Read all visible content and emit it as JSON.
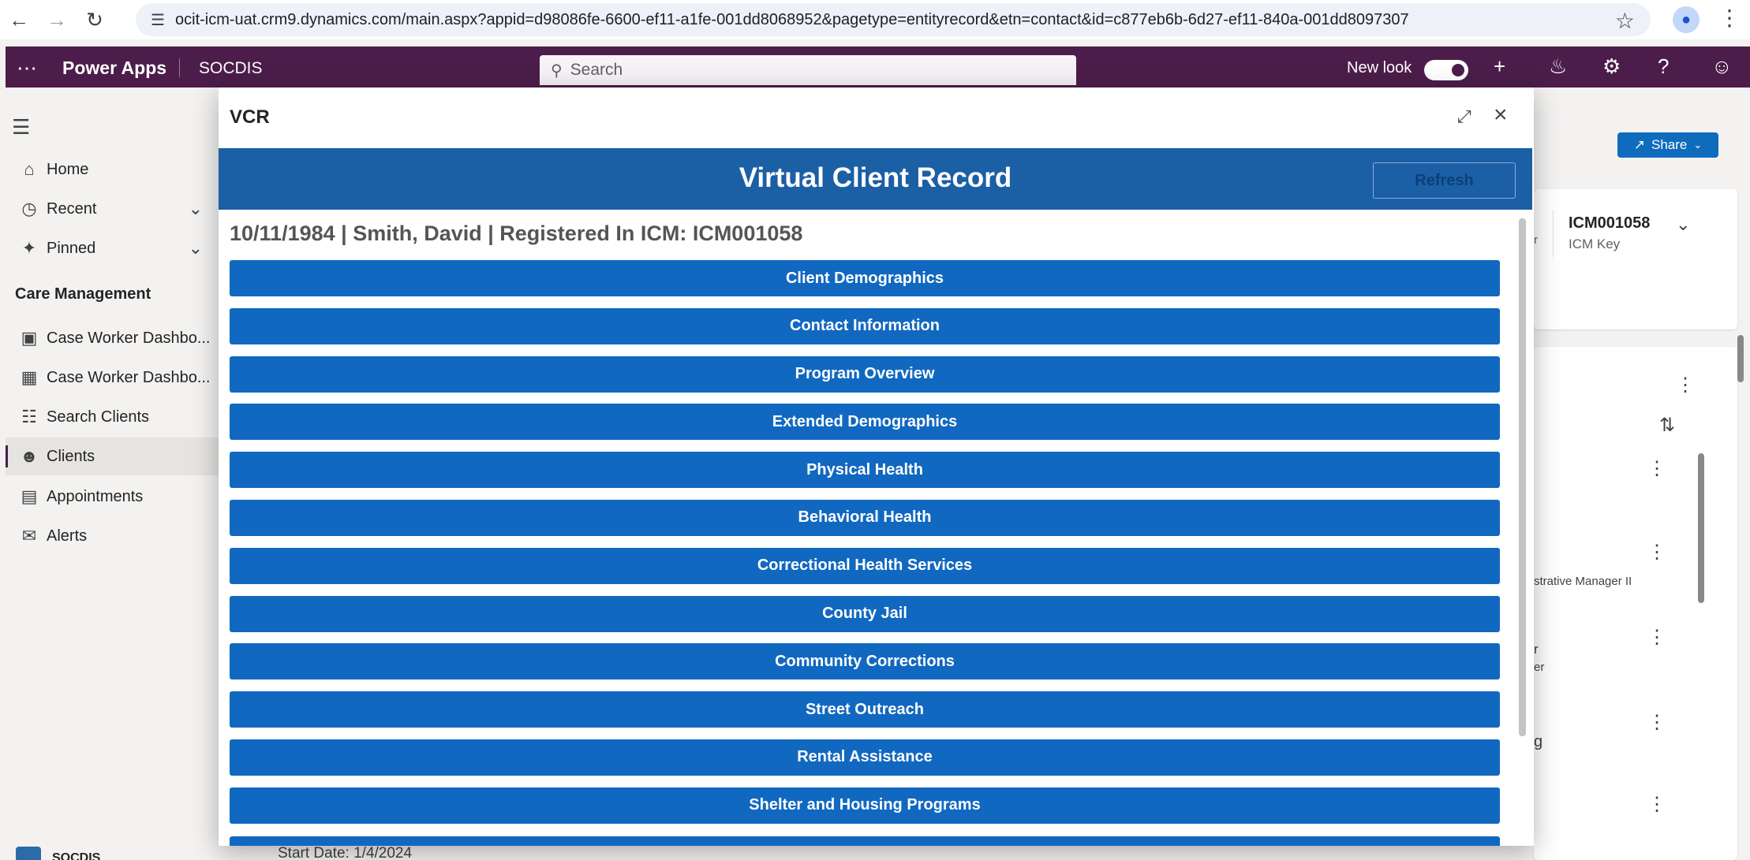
{
  "browser": {
    "url": "ocit-icm-uat.crm9.dynamics.com/main.aspx?appid=d98086fe-6600-ef11-a1fe-001dd8068952&pagetype=entityrecord&etn=contact&id=c877eb6b-6d27-ef11-840a-001dd8097307"
  },
  "header": {
    "app_name": "Power Apps",
    "environment": "SOCDIS",
    "search_placeholder": "Search",
    "new_look_label": "New look",
    "new_look_on": true
  },
  "nav": {
    "items": [
      {
        "label": "Home",
        "icon": "home-icon"
      },
      {
        "label": "Recent",
        "icon": "clock-icon"
      },
      {
        "label": "Pinned",
        "icon": "pin-icon"
      }
    ],
    "group_title": "Care Management",
    "group_items": [
      {
        "label": "Case Worker Dashbo...",
        "icon": "dashboard-icon"
      },
      {
        "label": "Case Worker Dashbo...",
        "icon": "dashboard-icon"
      },
      {
        "label": "Search Clients",
        "icon": "search-clients-icon"
      },
      {
        "label": "Clients",
        "icon": "person-icon",
        "active": true
      },
      {
        "label": "Appointments",
        "icon": "calendar-icon"
      },
      {
        "label": "Alerts",
        "icon": "envelope-icon"
      }
    ],
    "area": "SOCDIS"
  },
  "background": {
    "share_label": "Share",
    "icm_key_value": "ICM001058",
    "icm_key_label": "ICM Key",
    "snippet_1": "r",
    "snippet_2": "strative Manager II",
    "snippet_3": "r",
    "snippet_4": "er",
    "snippet_5": "g",
    "start_date": "Start Date: 1/4/2024"
  },
  "modal": {
    "title": "VCR",
    "banner_title": "Virtual Client Record",
    "refresh_label": "Refresh",
    "client_line": "10/11/1984 | Smith, David | Registered In ICM: ICM001058",
    "sections": [
      "Client Demographics",
      "Contact Information",
      "Program Overview",
      "Extended Demographics",
      "Physical Health",
      "Behavioral Health",
      "Correctional Health Services",
      "County Jail",
      "Community Corrections",
      "Street Outreach",
      "Rental Assistance",
      "Shelter and Housing Programs"
    ]
  },
  "colors": {
    "header_bg": "#4c1d4a",
    "banner_bg": "#1b5fa5",
    "section_bg": "#1168c0",
    "share_bg": "#0f6cbd"
  }
}
